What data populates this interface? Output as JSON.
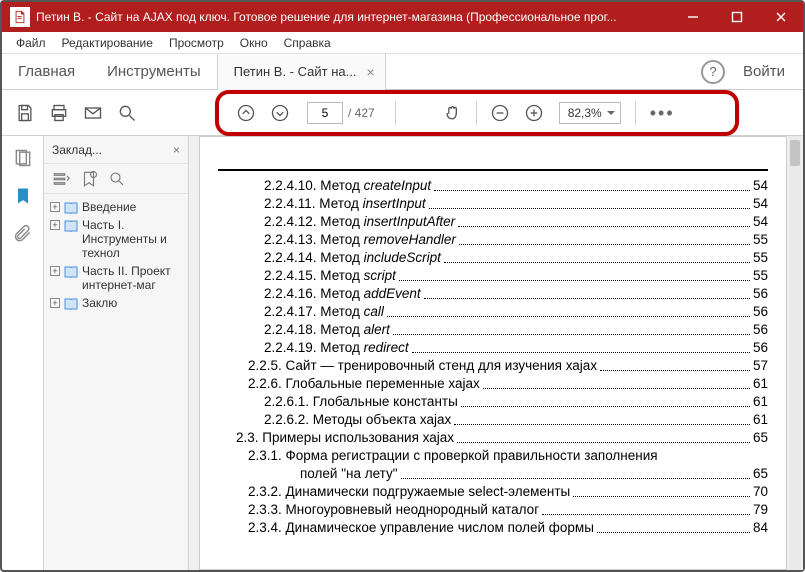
{
  "window": {
    "title": "Петин В. - Сайт на AJAX под ключ. Готовое решение для интернет-магазина (Профессиональное прог..."
  },
  "menubar": {
    "file": "Файл",
    "edit": "Редактирование",
    "view": "Просмотр",
    "window": "Окно",
    "help": "Справка"
  },
  "tabs": {
    "home": "Главная",
    "tools": "Инструменты",
    "doc": "Петин В. - Сайт на...",
    "login": "Войти"
  },
  "toolbar": {
    "page_current": "5",
    "page_total": "/ 427",
    "zoom": "82,3%"
  },
  "sidebar": {
    "title": "Заклад...",
    "items": [
      {
        "label": "Введение"
      },
      {
        "label": "Часть I. Инструменты и технол"
      },
      {
        "label": "Часть II. Проект интернет-маг"
      },
      {
        "label": "Заклю"
      }
    ]
  },
  "toc": [
    {
      "cls": "ind1",
      "text": "2.2.4.10. Метод ",
      "i": "createInput",
      "page": "54"
    },
    {
      "cls": "ind1",
      "text": "2.2.4.11. Метод ",
      "i": "insertInput",
      "page": "54"
    },
    {
      "cls": "ind1",
      "text": "2.2.4.12. Метод ",
      "i": "insertInputAfter",
      "page": "54"
    },
    {
      "cls": "ind1",
      "text": "2.2.4.13. Метод ",
      "i": "removeHandler",
      "page": "55"
    },
    {
      "cls": "ind1",
      "text": "2.2.4.14. Метод ",
      "i": "includeScript",
      "page": "55"
    },
    {
      "cls": "ind1",
      "text": "2.2.4.15. Метод ",
      "i": "script",
      "page": "55"
    },
    {
      "cls": "ind1",
      "text": "2.2.4.16. Метод ",
      "i": "addEvent",
      "page": "56"
    },
    {
      "cls": "ind1",
      "text": "2.2.4.17. Метод ",
      "i": "call",
      "page": "56"
    },
    {
      "cls": "ind1",
      "text": "2.2.4.18. Метод ",
      "i": "alert",
      "page": "56"
    },
    {
      "cls": "ind1",
      "text": "2.2.4.19. Метод ",
      "i": "redirect",
      "page": "56"
    },
    {
      "cls": "ind2",
      "text": "2.2.5. Сайт — тренировочный стенд для изучения хајах",
      "page": "57"
    },
    {
      "cls": "ind2",
      "text": "2.2.6. Глобальные переменные хајах",
      "page": "61"
    },
    {
      "cls": "ind1",
      "text": "2.2.6.1. Глобальные константы",
      "page": "61"
    },
    {
      "cls": "ind1",
      "text": "2.2.6.2. Методы объекта хајах",
      "page": "61"
    },
    {
      "cls": "ind3",
      "text": "2.3. Примеры использования хајах",
      "page": "65"
    },
    {
      "cls": "ind2",
      "text": "2.3.1. Форма регистрации с проверкой правильности заполнения",
      "page": ""
    },
    {
      "cls": "cont",
      "text": "полей \"на лету\"",
      "page": "65"
    },
    {
      "cls": "ind2",
      "text": "2.3.2. Динамически подгружаемые select-элементы",
      "page": "70"
    },
    {
      "cls": "ind2",
      "text": "2.3.3. Многоуровневый неоднородный каталог",
      "page": "79"
    },
    {
      "cls": "ind2",
      "text": "2.3.4. Динамическое управление числом полей формы",
      "page": "84"
    }
  ]
}
